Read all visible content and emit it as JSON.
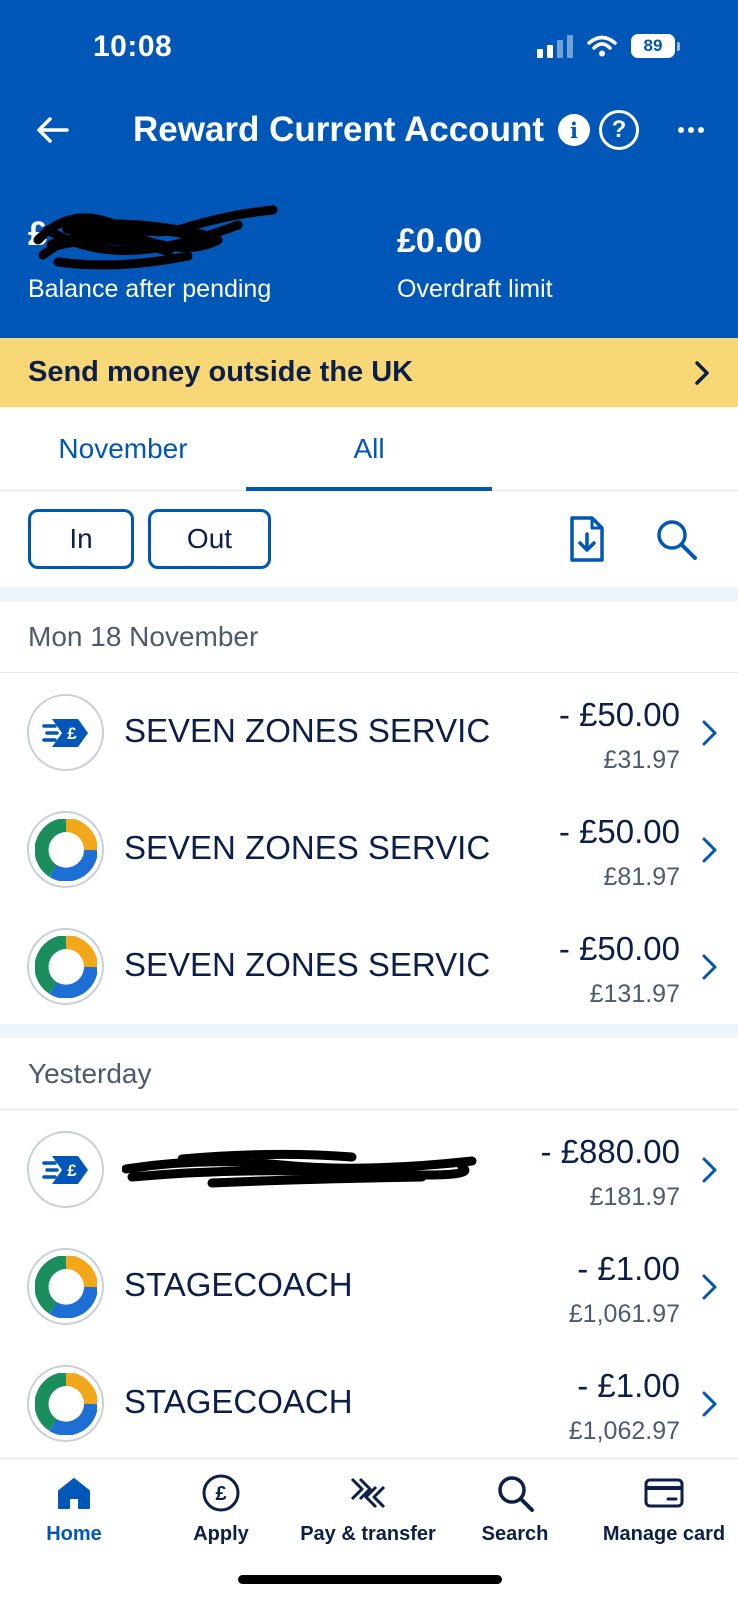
{
  "status_bar": {
    "time": "10:08",
    "battery": "89"
  },
  "header": {
    "title": "Reward Current Account",
    "balance_value": "£",
    "balance_label": "Balance after pending",
    "overdraft_value": "£0.00",
    "overdraft_label": "Overdraft limit"
  },
  "promo": {
    "text": "Send money outside the UK"
  },
  "tabs": [
    {
      "label": "November",
      "active": false
    },
    {
      "label": "All",
      "active": true
    }
  ],
  "filters": {
    "in_label": "In",
    "out_label": "Out"
  },
  "groups": [
    {
      "date": "Mon 18 November",
      "transactions": [
        {
          "icon": "transfer-icon",
          "name": "SEVEN ZONES SERVIC",
          "amount": "- £50.00",
          "balance": "£31.97"
        },
        {
          "icon": "card-payment-icon",
          "name": "SEVEN ZONES SERVIC",
          "amount": "- £50.00",
          "balance": "£81.97"
        },
        {
          "icon": "card-payment-icon",
          "name": "SEVEN ZONES SERVIC",
          "amount": "- £50.00",
          "balance": "£131.97"
        }
      ]
    },
    {
      "date": "Yesterday",
      "transactions": [
        {
          "icon": "transfer-icon",
          "name": "",
          "amount": "- £880.00",
          "balance": "£181.97",
          "redacted": true
        },
        {
          "icon": "card-payment-icon",
          "name": "STAGECOACH",
          "amount": "- £1.00",
          "balance": "£1,061.97"
        },
        {
          "icon": "card-payment-icon",
          "name": "STAGECOACH",
          "amount": "- £1.00",
          "balance": "£1,062.97"
        }
      ]
    }
  ],
  "bottom_nav": [
    {
      "label": "Home",
      "icon": "home-icon",
      "active": true
    },
    {
      "label": "Apply",
      "icon": "pound-circle-icon",
      "active": false
    },
    {
      "label": "Pay & transfer",
      "icon": "pay-transfer-icon",
      "active": false
    },
    {
      "label": "Search",
      "icon": "search-icon",
      "active": false
    },
    {
      "label": "Manage card",
      "icon": "card-icon",
      "active": false
    }
  ],
  "colors": {
    "brand_blue": "#0057b8",
    "promo_yellow": "#f8d776",
    "ring_orange": "#f3a81b",
    "ring_green": "#1a8e5c",
    "ring_blue": "#1d6fd6"
  }
}
